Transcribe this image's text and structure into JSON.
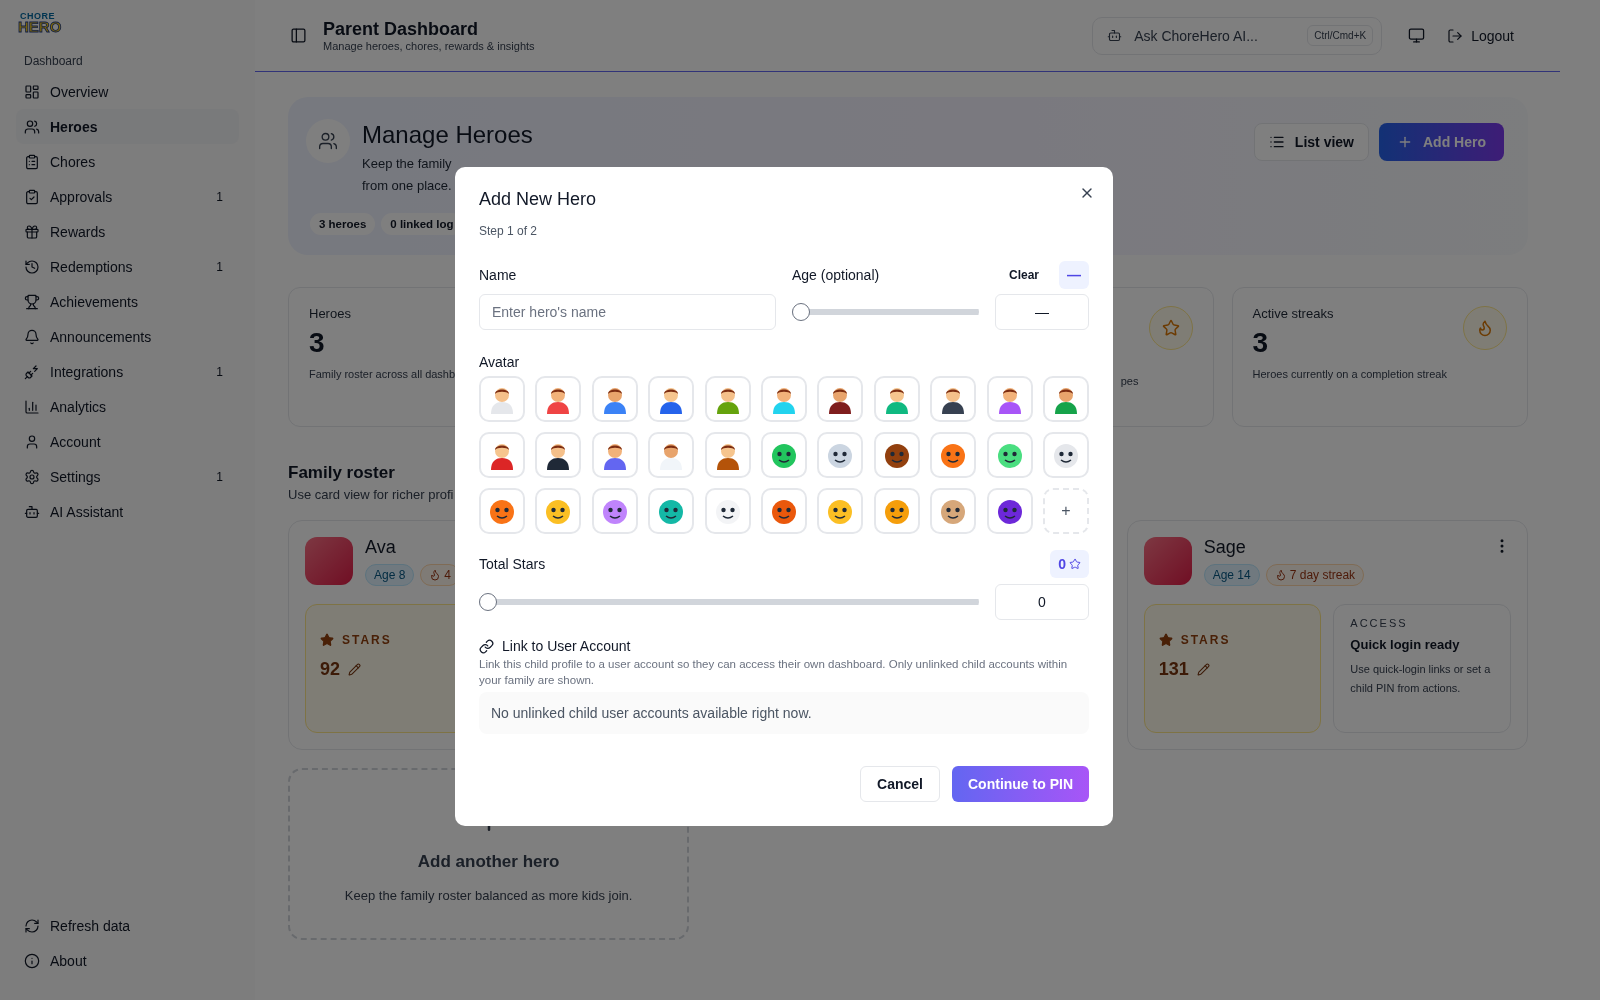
{
  "sidebar": {
    "logo": {
      "top": "CHORE",
      "bottom": "HERO"
    },
    "section": "Dashboard",
    "items": [
      {
        "label": "Overview",
        "selected": false
      },
      {
        "label": "Heroes",
        "selected": true
      },
      {
        "label": "Chores",
        "selected": false
      },
      {
        "label": "Approvals",
        "selected": false,
        "badge": "1"
      },
      {
        "label": "Rewards",
        "selected": false
      },
      {
        "label": "Redemptions",
        "selected": false,
        "badge": "1"
      },
      {
        "label": "Achievements",
        "selected": false
      },
      {
        "label": "Announcements",
        "selected": false
      },
      {
        "label": "Integrations",
        "selected": false,
        "badge": "1"
      },
      {
        "label": "Analytics",
        "selected": false
      },
      {
        "label": "Account",
        "selected": false
      },
      {
        "label": "Settings",
        "selected": false,
        "badge": "1"
      },
      {
        "label": "AI Assistant",
        "selected": false
      }
    ],
    "footer": [
      "Refresh data",
      "About"
    ]
  },
  "header": {
    "title": "Parent Dashboard",
    "subtitle": "Manage heroes, chores, rewards & insights",
    "assistant": {
      "label": "Ask ChoreHero AI...",
      "shortcut": "Ctrl/Cmd+K"
    },
    "logout": "Logout"
  },
  "heroes_panel": {
    "title": "Manage Heroes",
    "description_lines": [
      "Keep the family",
      "from one place."
    ],
    "chips": [
      "3 heroes",
      "0 linked log"
    ],
    "list_view": "List view",
    "add_hero": "Add Hero"
  },
  "stats": [
    {
      "title": "Heroes",
      "value": "3",
      "note": "Family roster across all dashb"
    },
    {
      "note": "pes"
    },
    {
      "title": "Active streaks",
      "value": "3",
      "note": "Heroes currently on a completion streak"
    }
  ],
  "roster": {
    "title": "Family roster",
    "subtitle": "Use card view for richer profi",
    "heroes": [
      {
        "name": "Ava",
        "age": "Age 8",
        "streak": "4",
        "stars_label": "STARS",
        "stars_value": "92"
      },
      {
        "name": "Sage",
        "age": "Age 14",
        "streak": "7 day streak",
        "stars_label": "STARS",
        "stars_value": "131",
        "access": {
          "label": "ACCESS",
          "title": "Quick login ready",
          "note": "Use quick-login links or set a child PIN from actions."
        }
      }
    ],
    "add_card": {
      "title": "Add another hero",
      "note": "Keep the family roster balanced as more kids join."
    }
  },
  "modal": {
    "title": "Add New Hero",
    "step": "Step 1 of 2",
    "name": {
      "label": "Name",
      "placeholder": "Enter hero's name"
    },
    "age": {
      "label": "Age (optional)",
      "clear": "Clear",
      "badge": "—",
      "level": 0,
      "value": "—"
    },
    "avatar": {
      "label": "Avatar",
      "add": "+",
      "options": [
        {
          "selected": false
        },
        {
          "selected": false
        },
        {
          "selected": false
        },
        {
          "selected": false
        },
        {
          "selected": false
        },
        {
          "selected": false
        },
        {
          "selected": false
        },
        {
          "selected": false
        },
        {
          "selected": false
        },
        {
          "selected": false
        },
        {
          "selected": false
        },
        {
          "selected": false
        },
        {
          "selected": false
        },
        {
          "selected": false
        },
        {
          "selected": false
        },
        {
          "selected": false
        },
        {
          "selected": false
        },
        {
          "selected": false
        },
        {
          "selected": false
        },
        {
          "selected": false
        },
        {
          "selected": false
        },
        {
          "selected": false
        },
        {
          "selected": false
        },
        {
          "selected": false
        },
        {
          "selected": false
        },
        {
          "selected": false
        },
        {
          "selected": false
        },
        {
          "selected": false
        },
        {
          "selected": false
        },
        {
          "selected": false
        },
        {
          "selected": false
        },
        {
          "selected": false
        }
      ]
    },
    "total_stars": {
      "label": "Total Stars",
      "badge": "0",
      "level": 0,
      "value": "0"
    },
    "link": {
      "title": "Link to User Account",
      "description": "Link this child profile to a user account so they can access their own dashboard. Only unlinked child accounts within your family are shown.",
      "empty": "No unlinked child user accounts available right now."
    },
    "buttons": {
      "cancel": "Cancel",
      "continue": "Continue to PIN"
    }
  }
}
